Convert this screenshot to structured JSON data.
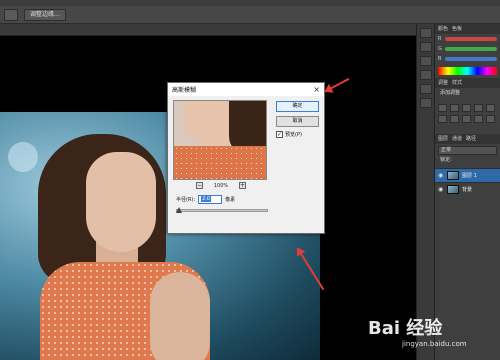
{
  "optbar": {
    "button_label": "调整边缘..."
  },
  "panels": {
    "color_tabs": [
      "颜色",
      "色板"
    ],
    "adjust_tabs": [
      "调整",
      "样式"
    ],
    "adjust_title": "添加调整",
    "layers_tabs": [
      "图层",
      "通道",
      "路径"
    ],
    "blend_mode": "正常",
    "lock_label": "锁定:",
    "sliders": [
      {
        "label": "R",
        "color": "#c84646"
      },
      {
        "label": "G",
        "color": "#46a846"
      },
      {
        "label": "B",
        "color": "#4678c8"
      }
    ],
    "layers": [
      {
        "name": "图层 1",
        "active": true
      },
      {
        "name": "背景",
        "active": false
      }
    ]
  },
  "dialog": {
    "title": "高斯模糊",
    "close": "×",
    "ok": "确定",
    "cancel": "取消",
    "preview_label": "预览(P)",
    "preview_checked": "✓",
    "zoom_minus": "−",
    "zoom_plus": "+",
    "zoom": "100%",
    "radius_label": "半径(R):",
    "radius_value": "2.0",
    "radius_unit": "像素"
  },
  "watermark": {
    "line1": "Bai 经验",
    "line2": "jingyan.baidu.com"
  },
  "colors": {
    "accent": "#3b7dd8",
    "arrow": "#e23b3b"
  }
}
